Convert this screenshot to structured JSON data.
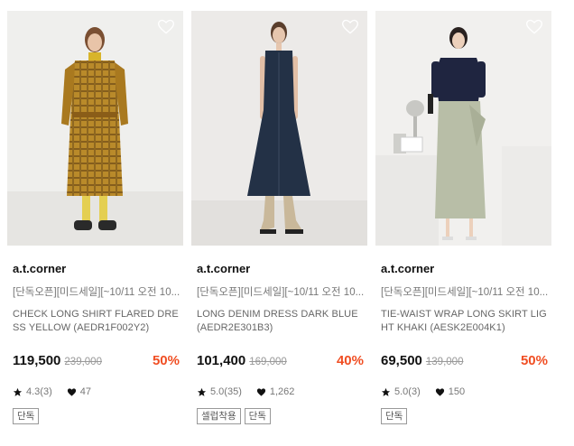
{
  "products": [
    {
      "brand": "a.t.corner",
      "promo": "[단독오픈][미드세일][~10/11 오전 10...",
      "name_line1": "CHECK LONG SHIRT FLARED DRE",
      "name_line2": "SS YELLOW (AEDR1F002Y2)",
      "price": "119,500",
      "original_price": "239,000",
      "discount": "50%",
      "rating": "4.3(3)",
      "likes": "47",
      "tags": [
        "단독"
      ]
    },
    {
      "brand": "a.t.corner",
      "promo": "[단독오픈][미드세일][~10/11 오전 10...",
      "name_line1": "LONG DENIM DRESS DARK BLUE",
      "name_line2": "(AEDR2E301B3)",
      "price": "101,400",
      "original_price": "169,000",
      "discount": "40%",
      "rating": "5.0(35)",
      "likes": "1,262",
      "tags": [
        "셀럽착용",
        "단독"
      ]
    },
    {
      "brand": "a.t.corner",
      "promo": "[단독오픈][미드세일][~10/11 오전 10...",
      "name_line1": "TIE-WAIST WRAP LONG SKIRT LIG",
      "name_line2": "HT KHAKI (AESK2E004K1)",
      "price": "69,500",
      "original_price": "139,000",
      "discount": "50%",
      "rating": "5.0(3)",
      "likes": "150",
      "tags": [
        "단독"
      ]
    }
  ],
  "colors": {
    "discount": "#f04e23",
    "text": "#111111",
    "muted": "#777777"
  },
  "icons": {
    "wishlist": "heart-outline-icon",
    "rating": "star-icon",
    "likes": "heart-icon"
  }
}
